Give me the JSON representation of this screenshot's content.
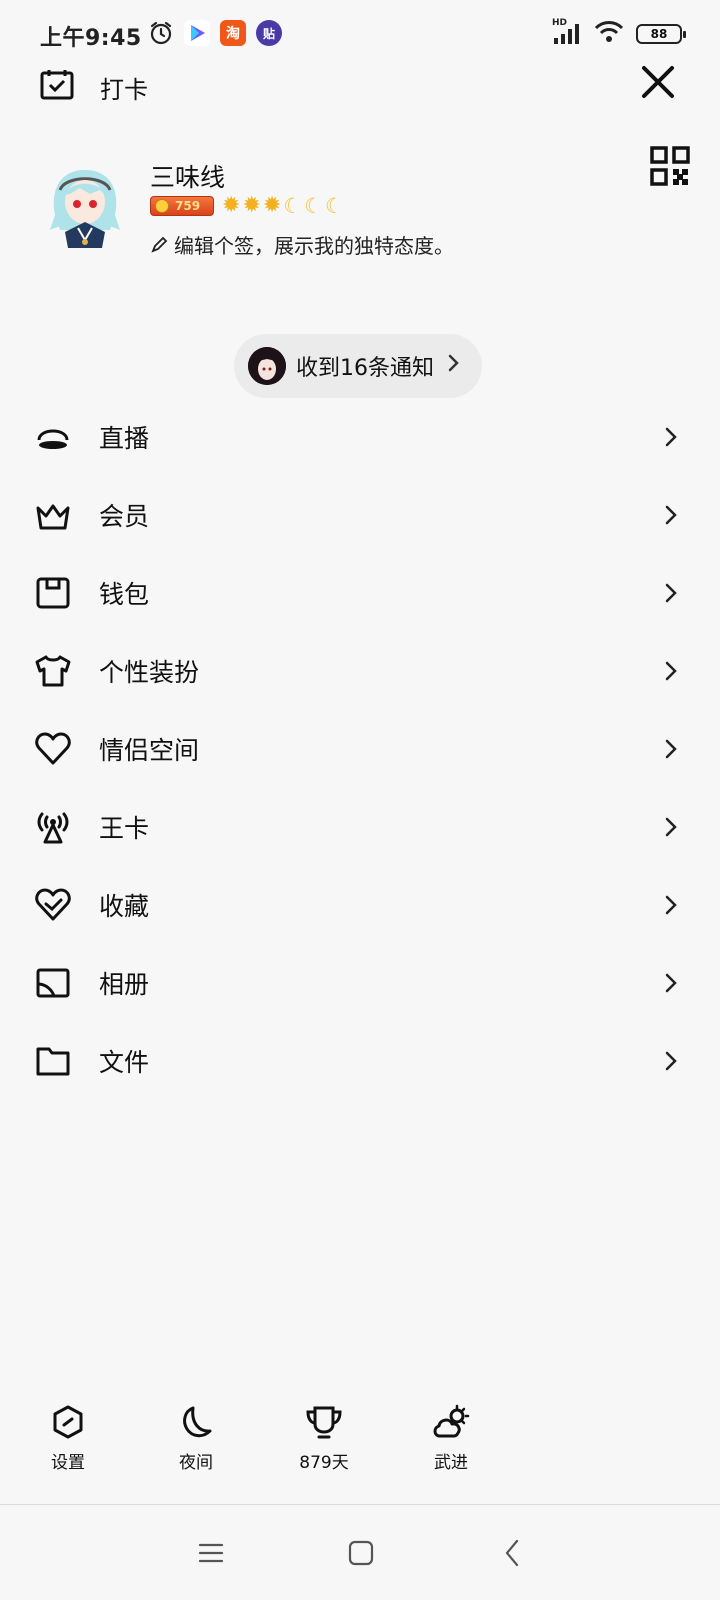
{
  "status_bar": {
    "time": "上午9:45",
    "taobao_label": "淘",
    "tieba_label": "贴",
    "battery": "88",
    "network": "HD",
    "icons": [
      "alarm-icon",
      "play-store-icon",
      "taobao-icon",
      "tieba-icon",
      "signal-icon",
      "wifi-icon",
      "battery-icon"
    ]
  },
  "header": {
    "checkin_label": "打卡",
    "close_icon": "close-icon"
  },
  "profile": {
    "name": "三味线",
    "level_badge": "759",
    "level_suns": 3,
    "level_moons": 3,
    "signature": "编辑个签，展示我的独特态度。"
  },
  "notification": {
    "text": "收到16条通知"
  },
  "menu": {
    "items": [
      {
        "label": "直播",
        "icon": "live-icon"
      },
      {
        "label": "会员",
        "icon": "crown-icon"
      },
      {
        "label": "钱包",
        "icon": "wallet-icon"
      },
      {
        "label": "个性装扮",
        "icon": "tshirt-icon"
      },
      {
        "label": "情侣空间",
        "icon": "heart-icon"
      },
      {
        "label": "王卡",
        "icon": "antenna-icon"
      },
      {
        "label": "收藏",
        "icon": "favorite-icon"
      },
      {
        "label": "相册",
        "icon": "album-icon"
      },
      {
        "label": "文件",
        "icon": "folder-icon"
      }
    ]
  },
  "toolbar": {
    "items": [
      {
        "label": "设置",
        "icon": "settings-icon"
      },
      {
        "label": "夜间",
        "icon": "moon-icon"
      },
      {
        "label": "879天",
        "icon": "trophy-icon"
      },
      {
        "label": "武进",
        "icon": "weather-icon"
      }
    ]
  },
  "colors": {
    "background": "#f7f7f7",
    "pill": "#ebebeb",
    "level_badge": "#e5542a",
    "sun": "#f2b11d"
  }
}
